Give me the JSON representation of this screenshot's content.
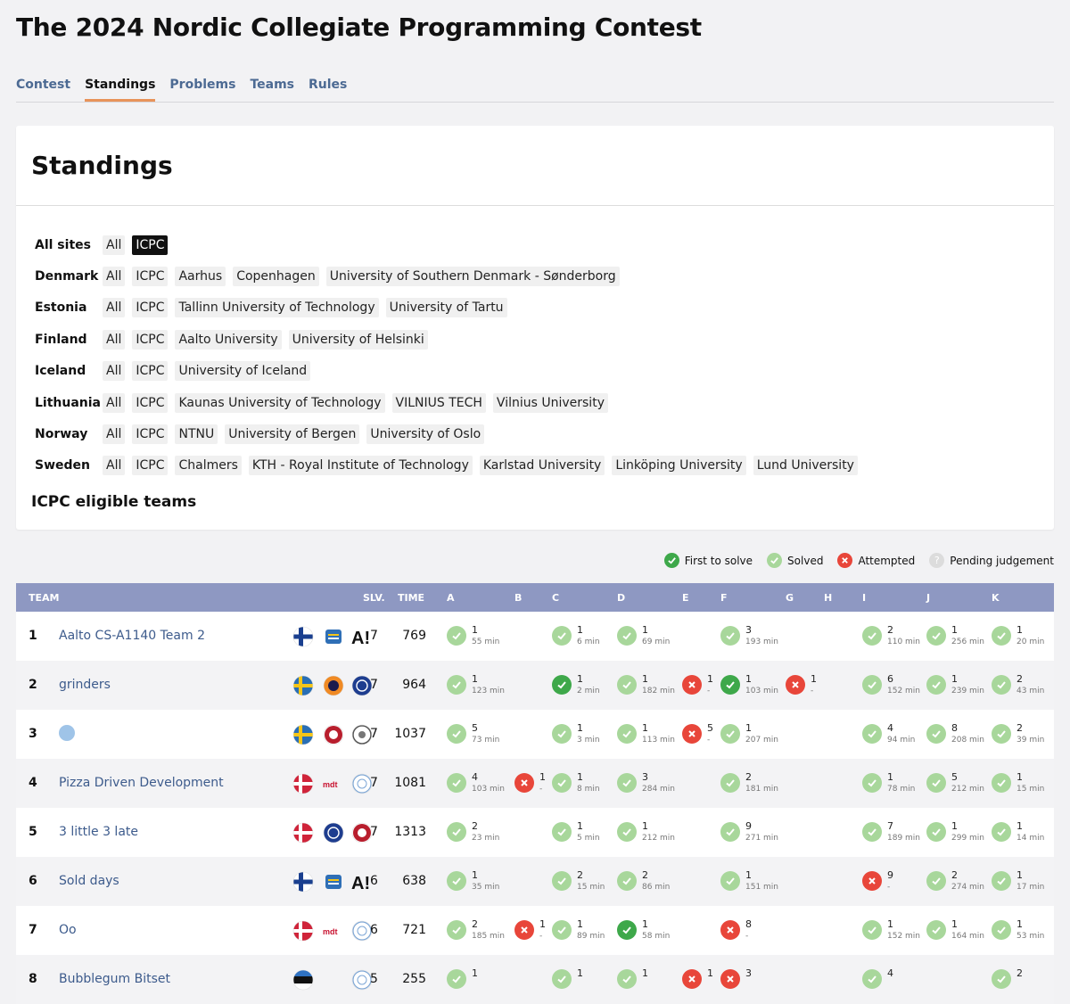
{
  "page": {
    "title": "The 2024 Nordic Collegiate Programming Contest"
  },
  "nav": {
    "tabs": [
      "Contest",
      "Standings",
      "Problems",
      "Teams",
      "Rules"
    ],
    "active": "Standings"
  },
  "standings": {
    "heading": "Standings",
    "eligible_heading": "ICPC eligible teams",
    "filters": [
      {
        "country": "All sites",
        "chips": [
          "All",
          "ICPC"
        ],
        "active": "ICPC"
      },
      {
        "country": "Denmark",
        "chips": [
          "All",
          "ICPC",
          "Aarhus",
          "Copenhagen",
          "University of Southern Denmark - Sønderborg"
        ]
      },
      {
        "country": "Estonia",
        "chips": [
          "All",
          "ICPC",
          "Tallinn University of Technology",
          "University of Tartu"
        ]
      },
      {
        "country": "Finland",
        "chips": [
          "All",
          "ICPC",
          "Aalto University",
          "University of Helsinki"
        ]
      },
      {
        "country": "Iceland",
        "chips": [
          "All",
          "ICPC",
          "University of Iceland"
        ]
      },
      {
        "country": "Lithuania",
        "chips": [
          "All",
          "ICPC",
          "Kaunas University of Technology",
          "VILNIUS TECH",
          "Vilnius University"
        ]
      },
      {
        "country": "Norway",
        "chips": [
          "All",
          "ICPC",
          "NTNU",
          "University of Bergen",
          "University of Oslo"
        ]
      },
      {
        "country": "Sweden",
        "chips": [
          "All",
          "ICPC",
          "Chalmers",
          "KTH - Royal Institute of Technology",
          "Karlstad University",
          "Linköping University",
          "Lund University"
        ]
      }
    ]
  },
  "legend": {
    "first": "First to solve",
    "solved": "Solved",
    "attempted": "Attempted",
    "pending": "Pending judgement"
  },
  "colors": {
    "first": "#3ea84a",
    "solved": "#a8d79b",
    "attempted": "#e8463a",
    "pending": "#dcdcdc",
    "header": "#8e98c2",
    "accent": "#e8935a",
    "link": "#3d5b8c"
  },
  "table": {
    "headers": {
      "team": "TEAM",
      "slv": "SLV.",
      "time": "TIME"
    },
    "problems": [
      "A",
      "B",
      "C",
      "D",
      "E",
      "F",
      "G",
      "H",
      "I",
      "J",
      "K"
    ],
    "rows": [
      {
        "rank": "1",
        "name": "Aalto CS-A1140 Team 2",
        "flags": [
          "fi",
          "uni-blue",
          "aalto"
        ],
        "solved": "7",
        "time": "769",
        "cells": [
          {
            "p": "A",
            "s": "solved",
            "n": "1",
            "m": "55 min"
          },
          {
            "p": "C",
            "s": "solved",
            "n": "1",
            "m": "6 min"
          },
          {
            "p": "D",
            "s": "solved",
            "n": "1",
            "m": "69 min"
          },
          {
            "p": "F",
            "s": "solved",
            "n": "3",
            "m": "193 min"
          },
          {
            "p": "I",
            "s": "solved",
            "n": "2",
            "m": "110 min"
          },
          {
            "p": "J",
            "s": "solved",
            "n": "1",
            "m": "256 min"
          },
          {
            "p": "K",
            "s": "solved",
            "n": "1",
            "m": "20 min"
          }
        ]
      },
      {
        "rank": "2",
        "name": "grinders",
        "flags": [
          "se",
          "uni-orange",
          "uni-navy"
        ],
        "solved": "7",
        "time": "964",
        "cells": [
          {
            "p": "A",
            "s": "solved",
            "n": "1",
            "m": "123 min"
          },
          {
            "p": "C",
            "s": "first",
            "n": "1",
            "m": "2 min"
          },
          {
            "p": "D",
            "s": "solved",
            "n": "1",
            "m": "182 min"
          },
          {
            "p": "E",
            "s": "attempted",
            "n": "1",
            "m": "-"
          },
          {
            "p": "F",
            "s": "first",
            "n": "1",
            "m": "103 min"
          },
          {
            "p": "G",
            "s": "attempted",
            "n": "1",
            "m": "-"
          },
          {
            "p": "I",
            "s": "solved",
            "n": "6",
            "m": "152 min"
          },
          {
            "p": "J",
            "s": "solved",
            "n": "1",
            "m": "239 min"
          },
          {
            "p": "K",
            "s": "solved",
            "n": "2",
            "m": "43 min"
          }
        ]
      },
      {
        "rank": "3",
        "name": "",
        "avatar": true,
        "flags": [
          "se",
          "uni-red",
          "uni-grey"
        ],
        "solved": "7",
        "time": "1037",
        "cells": [
          {
            "p": "A",
            "s": "solved",
            "n": "5",
            "m": "73 min"
          },
          {
            "p": "C",
            "s": "solved",
            "n": "1",
            "m": "3 min"
          },
          {
            "p": "D",
            "s": "solved",
            "n": "1",
            "m": "113 min"
          },
          {
            "p": "E",
            "s": "attempted",
            "n": "5",
            "m": "-"
          },
          {
            "p": "F",
            "s": "solved",
            "n": "1",
            "m": "207 min"
          },
          {
            "p": "I",
            "s": "solved",
            "n": "4",
            "m": "94 min"
          },
          {
            "p": "J",
            "s": "solved",
            "n": "8",
            "m": "208 min"
          },
          {
            "p": "K",
            "s": "solved",
            "n": "2",
            "m": "39 min"
          }
        ]
      },
      {
        "rank": "4",
        "name": "Pizza Driven Development",
        "flags": [
          "dk",
          "mdt",
          "uni-light"
        ],
        "solved": "7",
        "time": "1081",
        "cells": [
          {
            "p": "A",
            "s": "solved",
            "n": "4",
            "m": "103 min"
          },
          {
            "p": "B",
            "s": "attempted",
            "n": "1",
            "m": "-"
          },
          {
            "p": "C",
            "s": "solved",
            "n": "1",
            "m": "8 min"
          },
          {
            "p": "D",
            "s": "solved",
            "n": "3",
            "m": "284 min"
          },
          {
            "p": "F",
            "s": "solved",
            "n": "2",
            "m": "181 min"
          },
          {
            "p": "I",
            "s": "solved",
            "n": "1",
            "m": "78 min"
          },
          {
            "p": "J",
            "s": "solved",
            "n": "5",
            "m": "212 min"
          },
          {
            "p": "K",
            "s": "solved",
            "n": "1",
            "m": "15 min"
          }
        ]
      },
      {
        "rank": "5",
        "name": "3 little 3 late",
        "flags": [
          "dk",
          "uni-navy",
          "uni-red"
        ],
        "solved": "7",
        "time": "1313",
        "cells": [
          {
            "p": "A",
            "s": "solved",
            "n": "2",
            "m": "23 min"
          },
          {
            "p": "C",
            "s": "solved",
            "n": "1",
            "m": "5 min"
          },
          {
            "p": "D",
            "s": "solved",
            "n": "1",
            "m": "212 min"
          },
          {
            "p": "F",
            "s": "solved",
            "n": "9",
            "m": "271 min"
          },
          {
            "p": "I",
            "s": "solved",
            "n": "7",
            "m": "189 min"
          },
          {
            "p": "J",
            "s": "solved",
            "n": "1",
            "m": "299 min"
          },
          {
            "p": "K",
            "s": "solved",
            "n": "1",
            "m": "14 min"
          }
        ]
      },
      {
        "rank": "6",
        "name": "Sold days",
        "flags": [
          "fi",
          "uni-blue",
          "aalto"
        ],
        "solved": "6",
        "time": "638",
        "cells": [
          {
            "p": "A",
            "s": "solved",
            "n": "1",
            "m": "35 min"
          },
          {
            "p": "C",
            "s": "solved",
            "n": "2",
            "m": "15 min"
          },
          {
            "p": "D",
            "s": "solved",
            "n": "2",
            "m": "86 min"
          },
          {
            "p": "F",
            "s": "solved",
            "n": "1",
            "m": "151 min"
          },
          {
            "p": "I",
            "s": "attempted",
            "n": "9",
            "m": "-"
          },
          {
            "p": "J",
            "s": "solved",
            "n": "2",
            "m": "274 min"
          },
          {
            "p": "K",
            "s": "solved",
            "n": "1",
            "m": "17 min"
          }
        ]
      },
      {
        "rank": "7",
        "name": "Oo",
        "flags": [
          "dk",
          "mdt",
          "uni-light"
        ],
        "solved": "6",
        "time": "721",
        "cells": [
          {
            "p": "A",
            "s": "solved",
            "n": "2",
            "m": "185 min"
          },
          {
            "p": "B",
            "s": "attempted",
            "n": "1",
            "m": "-"
          },
          {
            "p": "C",
            "s": "solved",
            "n": "1",
            "m": "89 min"
          },
          {
            "p": "D",
            "s": "first",
            "n": "1",
            "m": "58 min"
          },
          {
            "p": "F",
            "s": "attempted",
            "n": "8",
            "m": "-"
          },
          {
            "p": "I",
            "s": "solved",
            "n": "1",
            "m": "152 min"
          },
          {
            "p": "J",
            "s": "solved",
            "n": "1",
            "m": "164 min"
          },
          {
            "p": "K",
            "s": "solved",
            "n": "1",
            "m": "53 min"
          }
        ]
      },
      {
        "rank": "8",
        "name": "Bubblegum Bitset",
        "flags": [
          "ee",
          "",
          "uni-light"
        ],
        "solved": "5",
        "time": "255",
        "cells": [
          {
            "p": "A",
            "s": "solved",
            "n": "1",
            "m": ""
          },
          {
            "p": "C",
            "s": "solved",
            "n": "1",
            "m": ""
          },
          {
            "p": "D",
            "s": "solved",
            "n": "1",
            "m": ""
          },
          {
            "p": "E",
            "s": "attempted",
            "n": "1",
            "m": ""
          },
          {
            "p": "F",
            "s": "attempted",
            "n": "3",
            "m": ""
          },
          {
            "p": "I",
            "s": "solved",
            "n": "4",
            "m": ""
          },
          {
            "p": "K",
            "s": "solved",
            "n": "2",
            "m": ""
          }
        ]
      }
    ]
  }
}
